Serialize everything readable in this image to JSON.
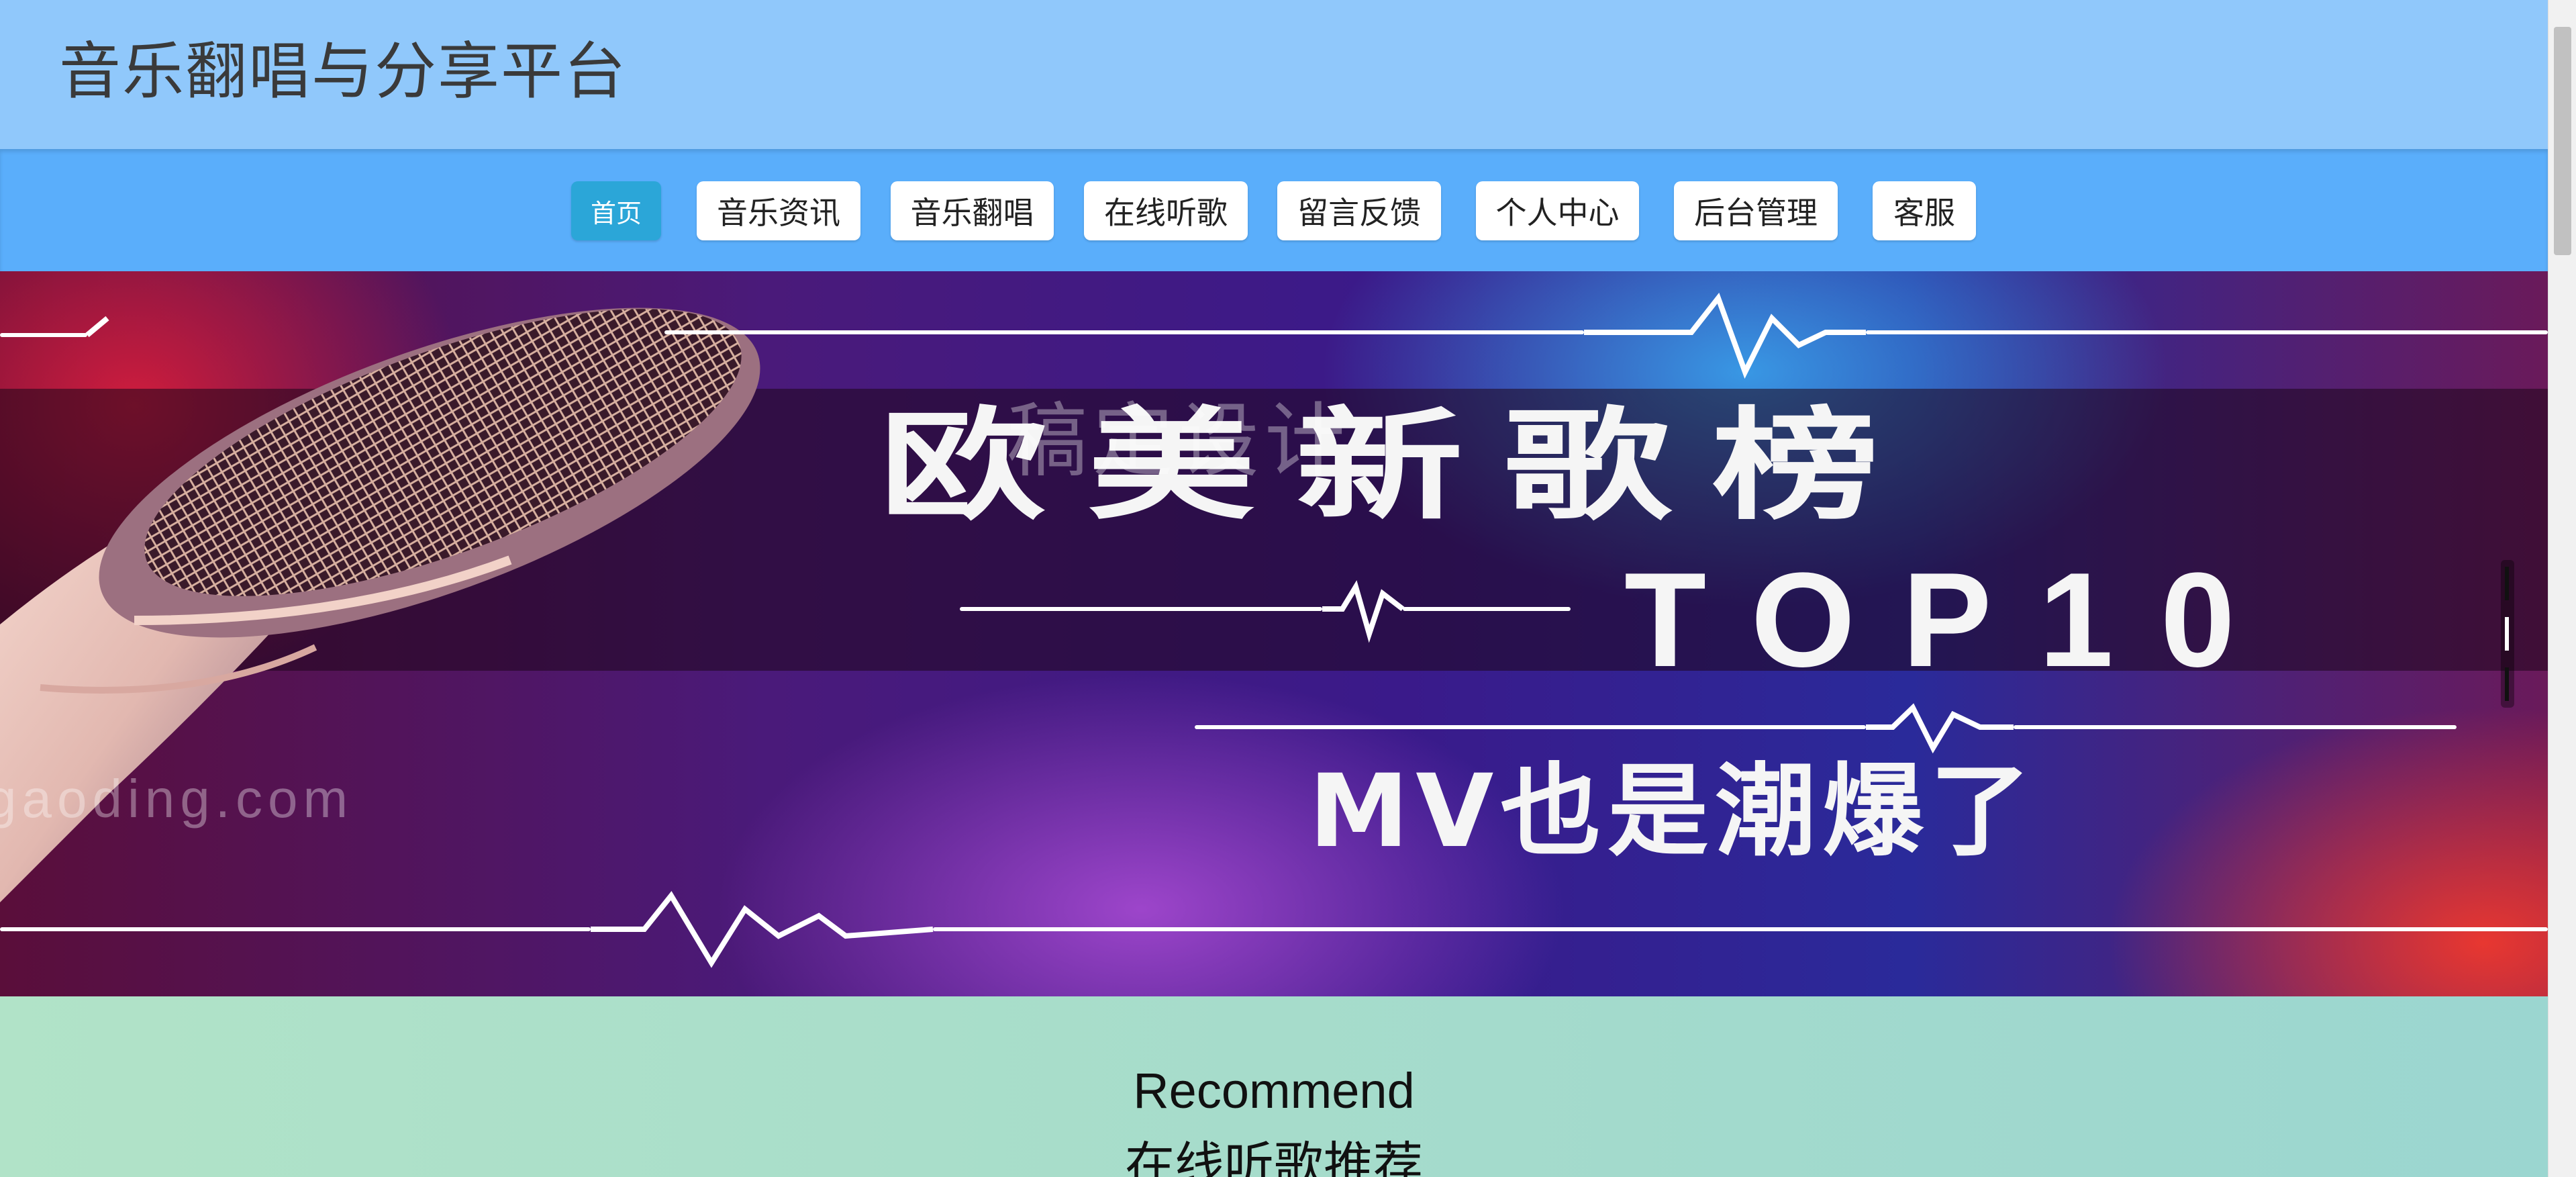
{
  "header": {
    "title": "音乐翻唱与分享平台"
  },
  "nav": {
    "items": [
      {
        "label": "首页",
        "active": true
      },
      {
        "label": "音乐资讯"
      },
      {
        "label": "音乐翻唱"
      },
      {
        "label": "在线听歌"
      },
      {
        "label": "留言反馈"
      },
      {
        "label": "个人中心"
      },
      {
        "label": "后台管理"
      },
      {
        "label": "客服"
      }
    ]
  },
  "banner": {
    "title": "欧美新歌榜",
    "top10": "TOP10",
    "subtitle": "MV也是潮爆了",
    "watermark": "gaoding.com",
    "watermark_cn": "稿定设计"
  },
  "section": {
    "title_en": "Recommend",
    "title_cn": "在线听歌推荐"
  },
  "colors": {
    "header_bg": "#90c8fb",
    "nav_bg": "#5aaefb",
    "nav_active": "#2ba6d8",
    "section_bg": "#a9dfc8"
  }
}
